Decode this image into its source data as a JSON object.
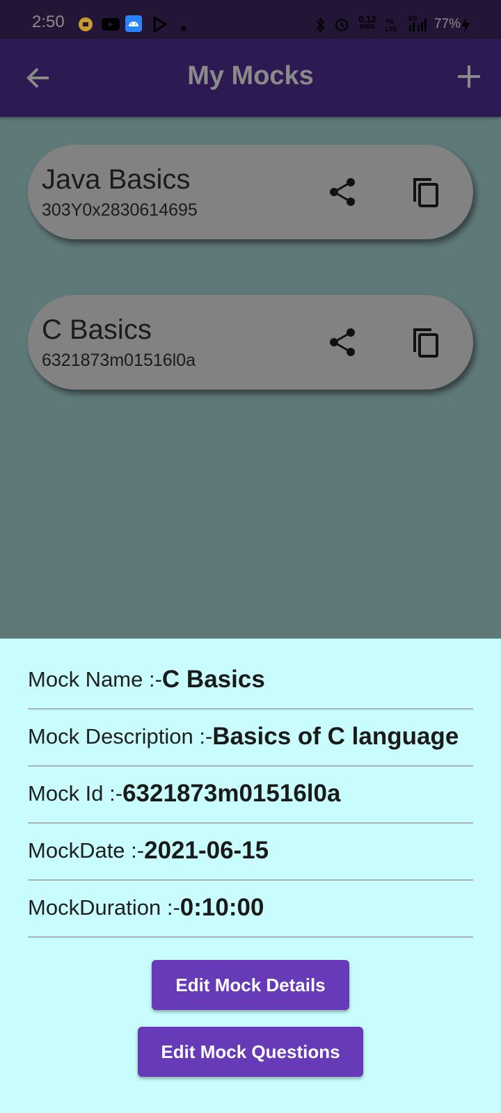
{
  "status_bar": {
    "time": "2:50",
    "network_speed": "0.12",
    "network_unit": "KB/S",
    "network_type": "4G",
    "battery": "77%"
  },
  "app_bar": {
    "title": "My Mocks"
  },
  "mocks": [
    {
      "name": "Java Basics",
      "id": "303Y0x2830614695"
    },
    {
      "name": "C Basics",
      "id": "6321873m01516l0a"
    }
  ],
  "details": {
    "name_label": "Mock Name :-",
    "name_value": "C Basics",
    "description_label": "Mock Description :-",
    "description_value": "Basics of C language",
    "id_label": "Mock Id :-",
    "id_value": "6321873m01516l0a",
    "date_label": "MockDate :-",
    "date_value": "2021-06-15",
    "duration_label": "MockDuration :-",
    "duration_value": "0:10:00"
  },
  "buttons": {
    "edit_details": "Edit Mock Details",
    "edit_questions": "Edit Mock Questions"
  },
  "colors": {
    "status_bar": "#221535",
    "app_bar": "#2e1a52",
    "scrim_background": "#5f7878",
    "card": "#828282",
    "sheet": "#c9fdfd",
    "button": "#673ab7"
  }
}
